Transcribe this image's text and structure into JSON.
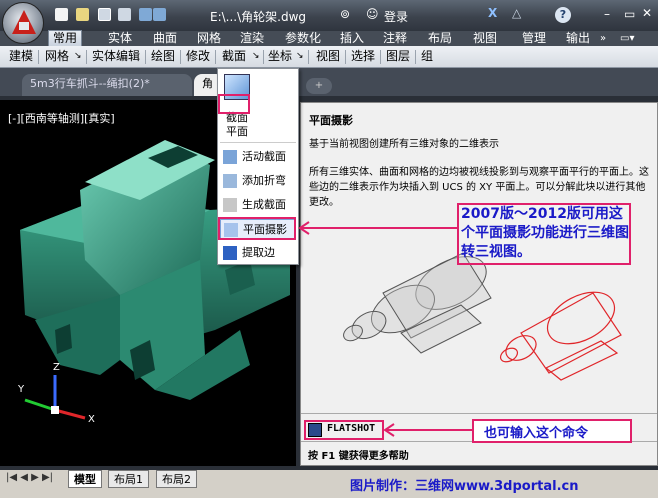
{
  "titlebar": {
    "title": "E:\\...\\角轮架.dwg",
    "search_icon": "binoculars-icon",
    "login_label": "登录",
    "help_icon": "help-icon"
  },
  "ribbon_tabs": [
    "常用",
    "实体",
    "曲面",
    "网格",
    "渲染",
    "参数化",
    "插入",
    "注释",
    "布局",
    "视图",
    "管理",
    "输出"
  ],
  "menubar": [
    "建模",
    "网格",
    "实体编辑",
    "绘图",
    "修改",
    "截面",
    "坐标",
    "视图",
    "选择",
    "图层",
    "组"
  ],
  "doc_tabs": [
    {
      "label": "5m3行车抓斗--绳扣(2)*",
      "active": false
    },
    {
      "label": "角",
      "active": true
    }
  ],
  "viewport": {
    "label": "[-][西南等轴测][真实]",
    "axes": {
      "x": "X",
      "y": "Y",
      "z": "Z"
    }
  },
  "dropdown": {
    "header_line1": "截面",
    "header_line2": "平面",
    "items": [
      "活动截面",
      "添加折弯",
      "生成截面",
      "平面摄影",
      "提取边"
    ]
  },
  "help_panel": {
    "title": "平面摄影",
    "subtitle": "基于当前视图创建所有三维对象的二维表示",
    "description": "所有三维实体、曲面和网格的边均被视线投影到与观察平面平行的平面上。这些边的二维表示作为块插入到 UCS 的 XY 平面上。可以分解此块以进行其他更改。",
    "command": "FLATSHOT",
    "f1_hint": "按 F1 键获得更多帮助"
  },
  "annotations": {
    "main_note": "2007版～2012版可用这个平面摄影功能进行三维图转三视图。",
    "cmd_note": "也可输入这个命令"
  },
  "bottom_tabs": [
    "模型",
    "布局1",
    "布局2"
  ],
  "credit": "图片制作：三维网www.3dportal.cn",
  "colors": {
    "model_green": "#2f8f78",
    "annotation_blue": "#1a1ac8",
    "highlight_pink": "#e0206a"
  }
}
